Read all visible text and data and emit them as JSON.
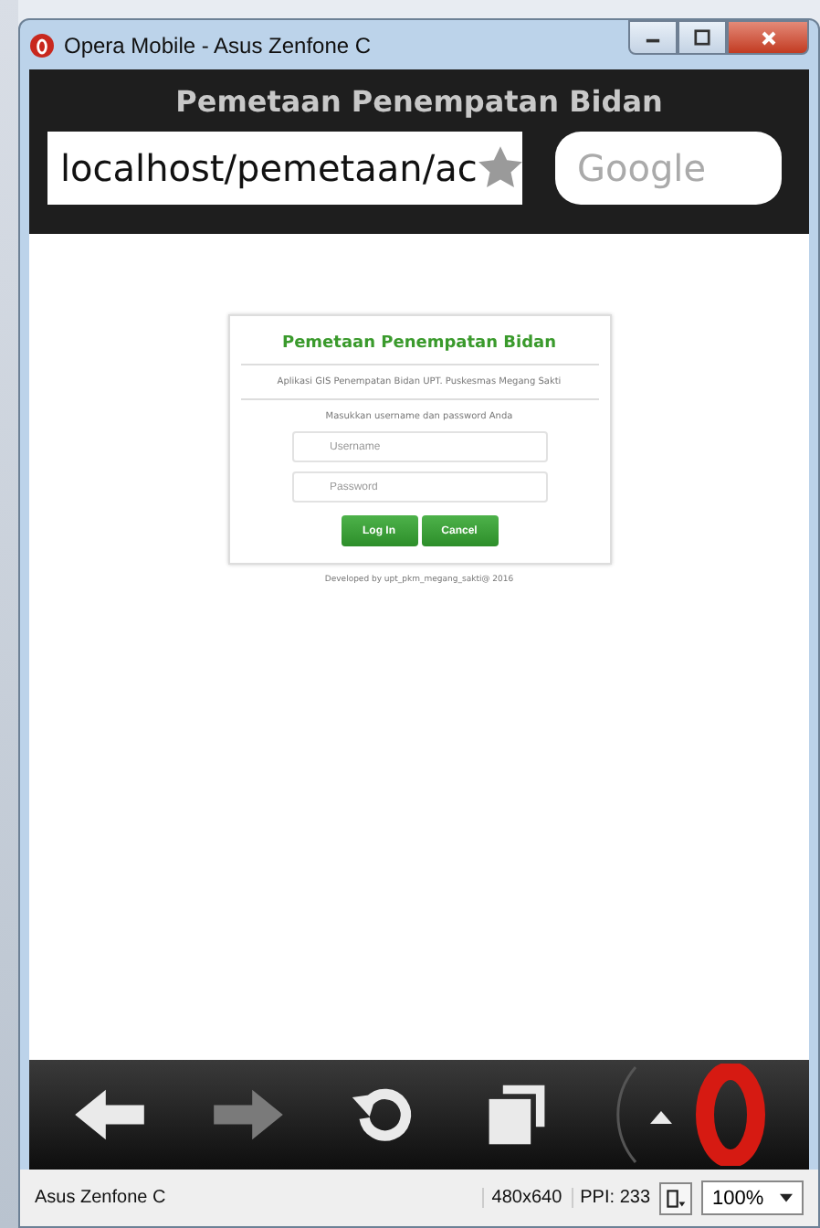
{
  "window": {
    "title": "Opera Mobile - Asus Zenfone C"
  },
  "browser": {
    "page_title": "Pemetaan Penempatan Bidan",
    "address": "localhost/pemetaan/ac",
    "search": {
      "placeholder": "Google"
    }
  },
  "login": {
    "title": "Pemetaan Penempatan Bidan",
    "subtitle": "Aplikasi GIS Penempatan Bidan UPT. Puskesmas Megang Sakti",
    "prompt": "Masukkan username dan password Anda",
    "username": {
      "placeholder": "Username"
    },
    "password": {
      "placeholder": "Password"
    },
    "buttons": [
      "Log In",
      "Cancel"
    ],
    "footer": "Developed by upt_pkm_megang_sakti@ 2016"
  },
  "toolbar": [
    {
      "kind": "back",
      "disabled": false
    },
    {
      "kind": "forward",
      "disabled": true
    },
    {
      "kind": "reload",
      "disabled": false
    },
    {
      "kind": "tabs",
      "disabled": false
    },
    {
      "kind": "menu",
      "disabled": false
    }
  ],
  "status_bar": {
    "device": "Asus Zenfone C",
    "resolution": "480x640",
    "ppi": "PPI: 233",
    "zoom": "100%"
  }
}
